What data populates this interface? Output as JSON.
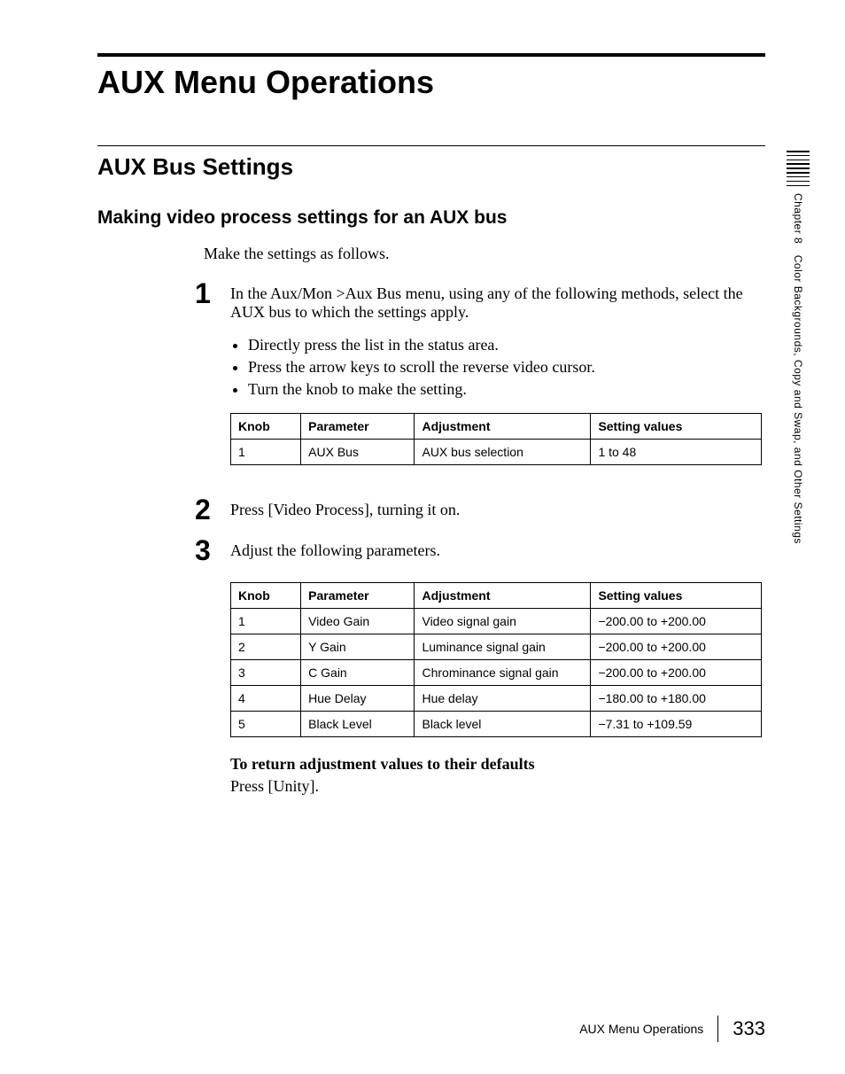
{
  "pageTitle": "AUX Menu Operations",
  "sectionTitle": "AUX Bus Settings",
  "subsectionTitle": "Making video process settings for an AUX bus",
  "introText": "Make the settings as follows.",
  "steps": {
    "s1": {
      "num": "1",
      "text": "In the Aux/Mon >Aux Bus menu, using any of the following methods, select the AUX bus to which the settings apply.",
      "bullets": {
        "b1": "Directly press the list in the status area.",
        "b2": "Press the arrow keys to scroll the reverse video cursor.",
        "b3": "Turn the knob to make the setting."
      }
    },
    "s2": {
      "num": "2",
      "text": "Press [Video Process], turning it on."
    },
    "s3": {
      "num": "3",
      "text": "Adjust the following parameters."
    }
  },
  "table1": {
    "headers": {
      "h1": "Knob",
      "h2": "Parameter",
      "h3": "Adjustment",
      "h4": "Setting values"
    },
    "rows": {
      "r1": {
        "c1": "1",
        "c2": "AUX Bus",
        "c3": "AUX bus selection",
        "c4": "1 to 48"
      }
    }
  },
  "table2": {
    "headers": {
      "h1": "Knob",
      "h2": "Parameter",
      "h3": "Adjustment",
      "h4": "Setting values"
    },
    "rows": {
      "r1": {
        "c1": "1",
        "c2": "Video Gain",
        "c3": "Video signal gain",
        "c4": "−200.00 to +200.00"
      },
      "r2": {
        "c1": "2",
        "c2": "Y Gain",
        "c3": "Luminance signal gain",
        "c4": "−200.00 to +200.00"
      },
      "r3": {
        "c1": "3",
        "c2": "C Gain",
        "c3": "Chrominance signal gain",
        "c4": "−200.00 to +200.00"
      },
      "r4": {
        "c1": "4",
        "c2": "Hue Delay",
        "c3": "Hue delay",
        "c4": "−180.00 to +180.00"
      },
      "r5": {
        "c1": "5",
        "c2": "Black Level",
        "c3": "Black level",
        "c4": "−7.31 to +109.59"
      }
    }
  },
  "defaults": {
    "heading": "To return adjustment values to their defaults",
    "text": "Press [Unity]."
  },
  "sideTab": "Chapter 8 Color Backgrounds, Copy and Swap, and Other Settings",
  "footer": {
    "title": "AUX Menu Operations",
    "page": "333"
  }
}
